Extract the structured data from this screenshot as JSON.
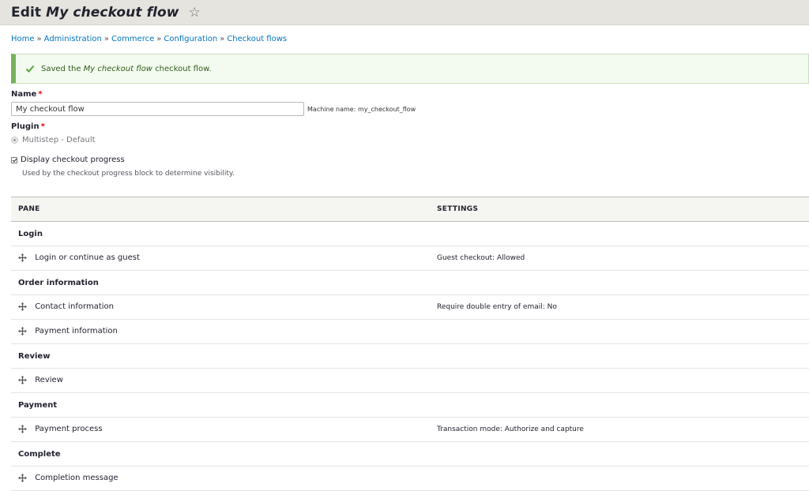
{
  "header": {
    "title_prefix": "Edit",
    "title_name": "My checkout flow"
  },
  "breadcrumb": {
    "items": [
      "Home",
      "Administration",
      "Commerce",
      "Configuration",
      "Checkout flows"
    ],
    "separator": "»"
  },
  "status": {
    "prefix": "Saved the",
    "name": "My checkout flow",
    "suffix": "checkout flow.",
    "color": "#77b259"
  },
  "form": {
    "name_label": "Name",
    "name_value": "My checkout flow",
    "machine_name": "Machine name: my_checkout_flow",
    "plugin_label": "Plugin",
    "plugin_option": "Multistep - Default",
    "progress_label": "Display checkout progress",
    "progress_checked": true,
    "progress_help": "Used by the checkout progress block to determine visibility."
  },
  "table": {
    "headers": [
      "PANE",
      "SETTINGS"
    ],
    "regions": [
      {
        "name": "Login",
        "panes": [
          {
            "label": "Login or continue as guest",
            "settings": "Guest checkout: Allowed"
          }
        ]
      },
      {
        "name": "Order information",
        "panes": [
          {
            "label": "Contact information",
            "settings": "Require double entry of email: No"
          },
          {
            "label": "Payment information",
            "settings": ""
          }
        ]
      },
      {
        "name": "Review",
        "panes": [
          {
            "label": "Review",
            "settings": ""
          }
        ]
      },
      {
        "name": "Payment",
        "panes": [
          {
            "label": "Payment process",
            "settings": "Transaction mode: Authorize and capture"
          }
        ]
      },
      {
        "name": "Complete",
        "panes": [
          {
            "label": "Completion message",
            "settings": ""
          }
        ]
      }
    ]
  },
  "icons": {
    "favorite": "star-outline-icon",
    "status": "checkmark-icon",
    "drag": "drag-handle-icon"
  }
}
